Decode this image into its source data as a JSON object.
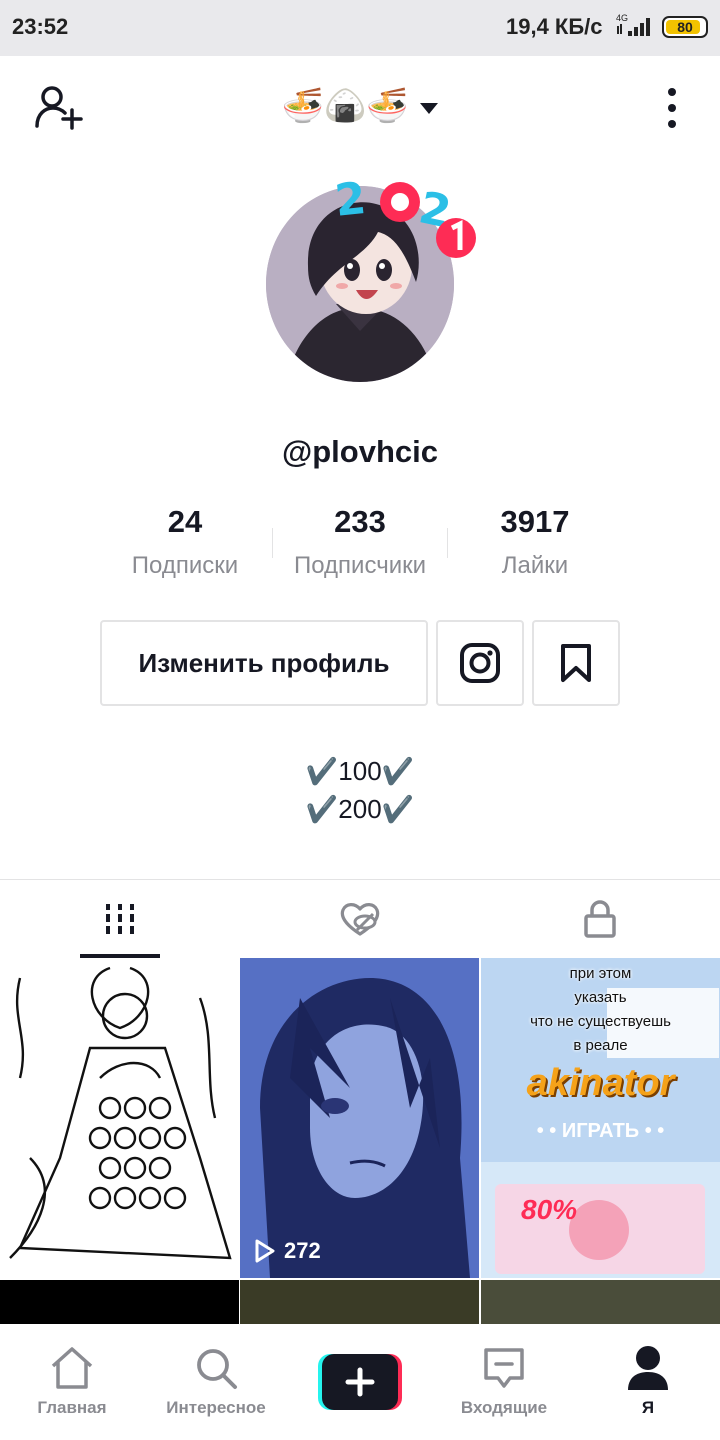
{
  "status_bar": {
    "time": "23:52",
    "network_speed": "19,4 КБ/с",
    "network_type": "4G",
    "battery": "80"
  },
  "header": {
    "title_emoji": "🍜🍙🍜",
    "add_user_icon": "add-user-icon",
    "more_icon": "more-vertical-icon"
  },
  "profile": {
    "badge_text": "2021",
    "username": "@plovhcic",
    "stats": [
      {
        "value": "24",
        "label": "Подписки"
      },
      {
        "value": "233",
        "label": "Подписчики"
      },
      {
        "value": "3917",
        "label": "Лайки"
      }
    ],
    "edit_button_label": "Изменить профиль",
    "bio_lines": [
      "✔️100✔️",
      "✔️200✔️"
    ]
  },
  "tabs": [
    {
      "name": "videos",
      "icon": "grid-icon",
      "active": true
    },
    {
      "name": "liked",
      "icon": "heart-hidden-icon",
      "active": false
    },
    {
      "name": "private",
      "icon": "lock-icon",
      "active": false
    }
  ],
  "grid": {
    "videos": [
      {
        "views": ""
      },
      {
        "views": "272"
      },
      {
        "views": "",
        "overlay_lines": [
          "при этом",
          "указать",
          "что не существуешь",
          "в реале"
        ],
        "brand": "akinator",
        "cta": "• • ИГРАТЬ • •",
        "percent": "80%"
      }
    ]
  },
  "bottom_nav": [
    {
      "label": "Главная",
      "icon": "home-icon"
    },
    {
      "label": "Интересное",
      "icon": "search-icon"
    },
    {
      "label": "",
      "icon": "plus-icon"
    },
    {
      "label": "Входящие",
      "icon": "inbox-icon"
    },
    {
      "label": "Я",
      "icon": "profile-icon"
    }
  ],
  "colors": {
    "text_primary": "#161823",
    "text_secondary": "#8a8b91",
    "border": "#e3e3e4",
    "accent_cyan": "#25f4ee",
    "accent_red": "#fe2c55"
  }
}
